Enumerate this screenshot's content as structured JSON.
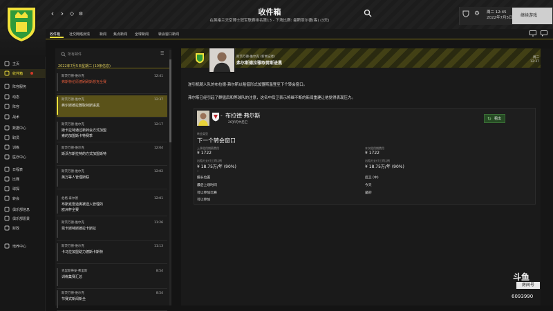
{
  "header": {
    "title": "收件箱",
    "subtitle": "在英格兰天空博士冠军联赛排名第13 - 下场比赛: 曼斯菲尔德(客) (3天)",
    "date_line1": "周二 12:45",
    "date_line2": "2022年7月5日",
    "continue_label": "继续游戏"
  },
  "tabs": [
    "收件箱",
    "社交网络反馈",
    "新闻",
    "焦点新闻",
    "全球新闻",
    "转会窗口新闻"
  ],
  "sidebar": {
    "items": [
      {
        "label": "主页",
        "icon": "home-icon"
      },
      {
        "label": "收件箱",
        "icon": "inbox-icon",
        "active": true,
        "badge": true
      },
      {
        "label": "阵容服务",
        "icon": "squad-icon"
      },
      {
        "label": "动态",
        "icon": "dynamics-icon"
      },
      {
        "label": "阵容",
        "icon": "tactics-icon"
      },
      {
        "label": "战术",
        "icon": "board-icon"
      },
      {
        "label": "数据中心",
        "icon": "data-icon"
      },
      {
        "label": "职员",
        "icon": "staff-icon"
      },
      {
        "label": "训练",
        "icon": "training-icon"
      },
      {
        "label": "医疗中心",
        "icon": "medical-icon"
      },
      {
        "label": "日程表",
        "icon": "calendar-icon"
      },
      {
        "label": "比赛",
        "icon": "match-icon"
      },
      {
        "label": "球探",
        "icon": "scout-icon"
      },
      {
        "label": "转会",
        "icon": "transfer-icon"
      },
      {
        "label": "俱乐部信息",
        "icon": "club-icon"
      },
      {
        "label": "俱乐部愿景",
        "icon": "vision-icon"
      },
      {
        "label": "财政",
        "icon": "finance-icon"
      },
      {
        "label": "培养中心",
        "icon": "development-icon"
      }
    ]
  },
  "list": {
    "search_placeholder": "所有邮件",
    "group_label": "2022年7月5日星期二 (10条信息)",
    "messages": [
      {
        "sender": "斯茨万德·维尔克",
        "subject": "弗斯特伦原德刷刷斯想克全赛",
        "time": "12:41",
        "unread": true
      },
      {
        "sender": "斯茨万德·维尔克",
        "subject": "弗尔斯德拉雅取荷斯进黑",
        "time": "12:37",
        "selected": true
      },
      {
        "sender": "斯茨万德·维尔克",
        "subject": "斯卡拉特通过新转会方式加盟",
        "subject2": "索的加盟斯卡特赛季",
        "time": "12:17"
      },
      {
        "sender": "斯茨万德·维尔克",
        "subject": "斯沃尔斯拉特的方式加盟斯特",
        "subject2": "",
        "time": "12:04"
      },
      {
        "sender": "斯茨万德·维尔克",
        "subject": "英万等人管理斯联",
        "time": "12:02"
      },
      {
        "sender": "伯格·泰尔德",
        "subject": "布斯克雷迪奥被选入管理的",
        "subject2": "欧洲杯全赛",
        "time": "12:01"
      },
      {
        "sender": "斯茨万德·维尔克",
        "subject": "昆卡斯特斯德拉卡斯拉",
        "time": "11:26"
      },
      {
        "sender": "斯茨万德·维尔克",
        "subject": "卡马拉加盟助力德斯卡斯特",
        "time": "11:13"
      },
      {
        "sender": "克里斯蒂安·弗里斯",
        "subject": "训练集赛汇总",
        "time": "8:54"
      },
      {
        "sender": "斯茨万德·维尔克",
        "subject": "节赛式新闻新全",
        "time": "8:54"
      }
    ]
  },
  "message": {
    "sender": "斯茨万德·维尔克 (新闻记者)",
    "subject": "弗尔斯德拉雅取荷斯进黑",
    "date": "周二",
    "time": "12:37",
    "body1": "遂引机随人队的布拉德·弗尔斯以租借形式加盟斯温登至下个转会窗口。",
    "body2": "弗尔斯已经引起了群猛后和等球队的注意，这名中后卫表示将继不断的新闻重建让他觉得表现压力。",
    "card": {
      "name": "布拉德·弗尔斯",
      "position": "26岁的中后卫",
      "button_label": "租出",
      "type_label": "转会类型",
      "type_value": "下一个转会窗口",
      "fee_label1": "上季租用期薪费用",
      "fee_value1": "¥ 1722",
      "fee_label2": "本次租用期费用",
      "fee_value2": "¥ 1722",
      "wage_label1": "出租方支付工资比例",
      "wage_value1": "¥ 18.75万/年 (90%)",
      "wage_label2": "出租方支付工资比例",
      "wage_value2": "¥ 18.75万/年 (90%)",
      "rows_left": [
        "擅长位置",
        "最后上场时间",
        "可以参加比赛",
        "可以参加"
      ],
      "rows_right": [
        "后卫 (中)",
        "今天",
        "是的",
        ""
      ]
    }
  },
  "watermark": {
    "logo": "斗鱼",
    "tag": "房间号",
    "room": "6093990"
  }
}
